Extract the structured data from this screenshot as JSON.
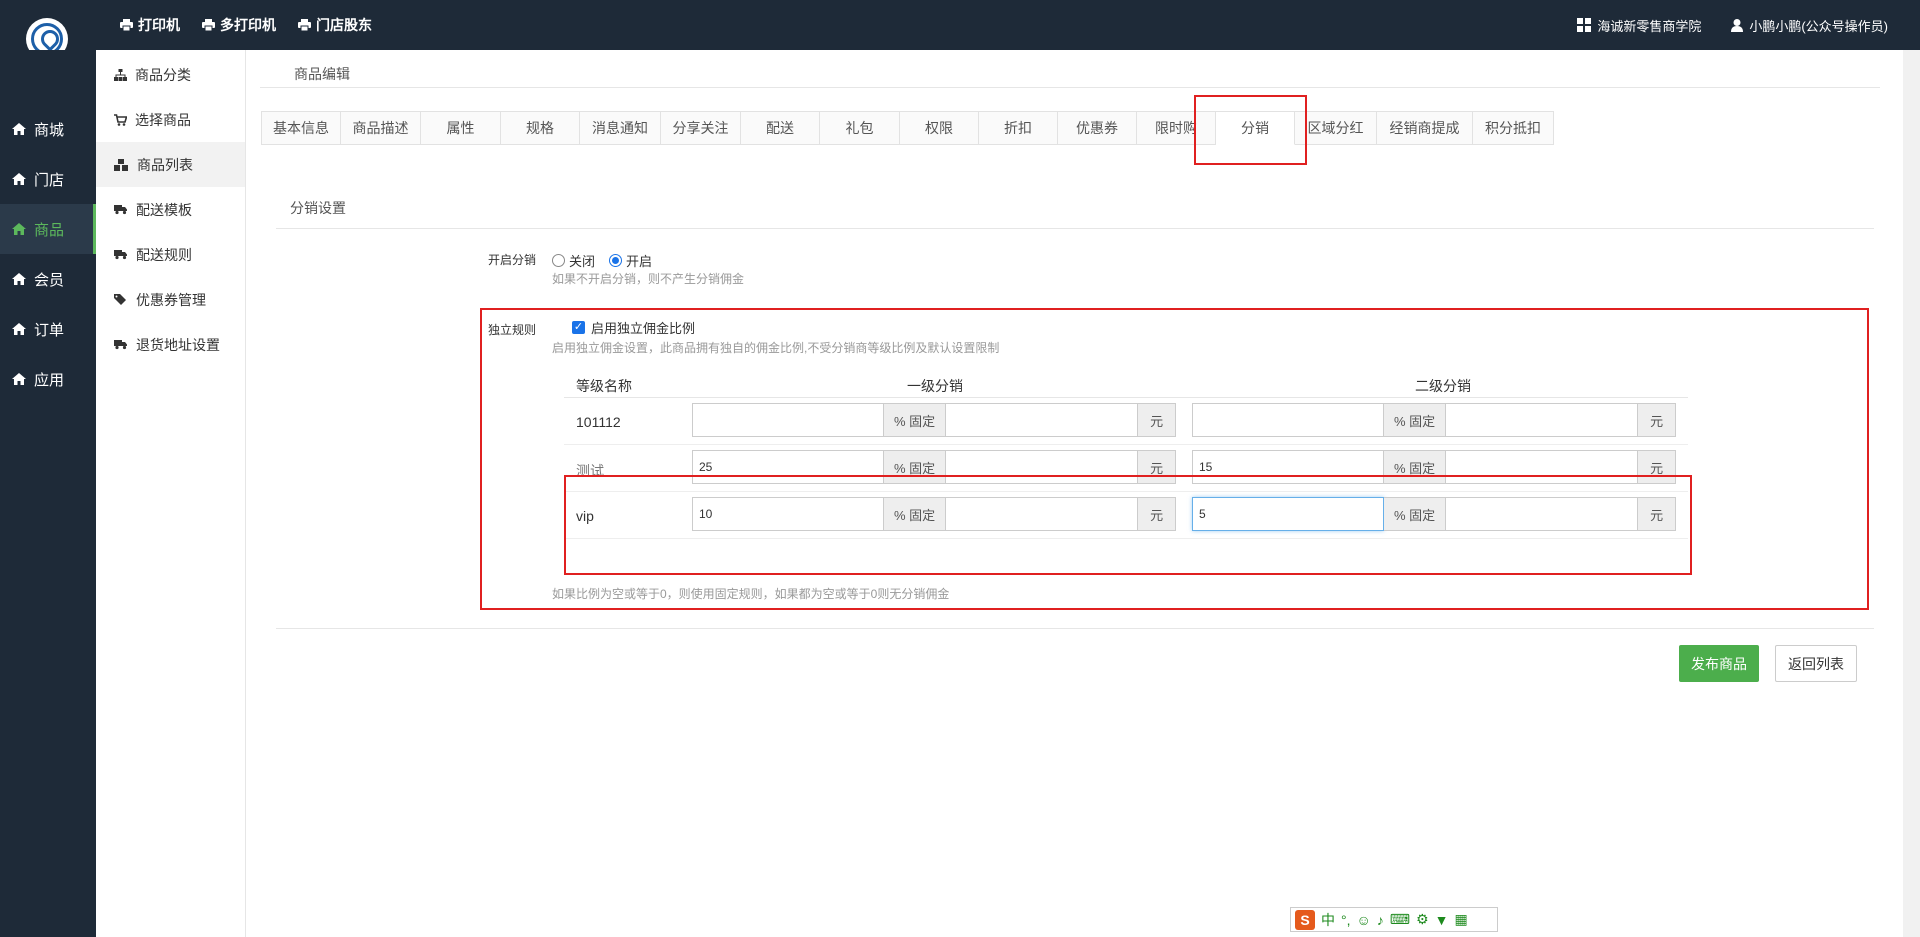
{
  "topbar": {
    "links": [
      {
        "label": "打印机",
        "icon": "printer-icon"
      },
      {
        "label": "多打印机",
        "icon": "printer-icon"
      },
      {
        "label": "门店股东",
        "icon": "printer-icon"
      }
    ],
    "academy": "海诚新零售商学院",
    "user": "小鹏小鹏(公众号操作员)"
  },
  "leftnav": {
    "items": [
      {
        "label": "商城",
        "icon": "home-icon"
      },
      {
        "label": "门店",
        "icon": "home-icon"
      },
      {
        "label": "商品",
        "icon": "home-icon"
      },
      {
        "label": "会员",
        "icon": "home-icon"
      },
      {
        "label": "订单",
        "icon": "home-icon"
      },
      {
        "label": "应用",
        "icon": "home-icon"
      }
    ]
  },
  "submenu": {
    "items": [
      {
        "label": "商品分类",
        "icon": "sitemap-icon"
      },
      {
        "label": "选择商品",
        "icon": "cart-icon"
      },
      {
        "label": "商品列表",
        "icon": "cubes-icon"
      },
      {
        "label": "配送模板",
        "icon": "truck-icon"
      },
      {
        "label": "配送规则",
        "icon": "truck-icon"
      },
      {
        "label": "优惠券管理",
        "icon": "tags-icon"
      },
      {
        "label": "退货地址设置",
        "icon": "truck-icon"
      }
    ]
  },
  "main": {
    "page_title": "商品编辑",
    "tabs": [
      "基本信息",
      "商品描述",
      "属性",
      "规格",
      "消息通知",
      "分享关注",
      "配送",
      "礼包",
      "权限",
      "折扣",
      "优惠券",
      "限时购",
      "分销",
      "区域分红",
      "经销商提成",
      "积分抵扣"
    ],
    "section_title": "分销设置",
    "enable": {
      "label": "开启分销",
      "options": [
        "关闭",
        "开启"
      ],
      "selected": "开启",
      "help": "如果不开启分销，则不产生分销佣金"
    },
    "independent": {
      "label": "独立规则",
      "checkbox_label": "启用独立佣金比例",
      "checked": true,
      "help": "启用独立佣金设置，此商品拥有独自的佣金比例,不受分销商等级比例及默认设置限制"
    },
    "table": {
      "headers": [
        "等级名称",
        "一级分销",
        "二级分销"
      ],
      "percent_addon": "% 固定",
      "yuan_addon": "元",
      "rows": [
        {
          "name": "101112",
          "level1": "",
          "level2": ""
        },
        {
          "name": "测试",
          "level1": "25",
          "level2": "15"
        },
        {
          "name": "vip",
          "level1": "10",
          "level2": "5"
        }
      ]
    },
    "footer_help": "如果比例为空或等于0，则使用固定规则，如果都为空或等于0则无分销佣金",
    "publish_button": "发布商品",
    "back_button": "返回列表"
  },
  "ime": {
    "lang": "中"
  },
  "colors": {
    "accent": "#5cb85c",
    "dark": "#1e2a38",
    "highlight": "#e02020"
  }
}
